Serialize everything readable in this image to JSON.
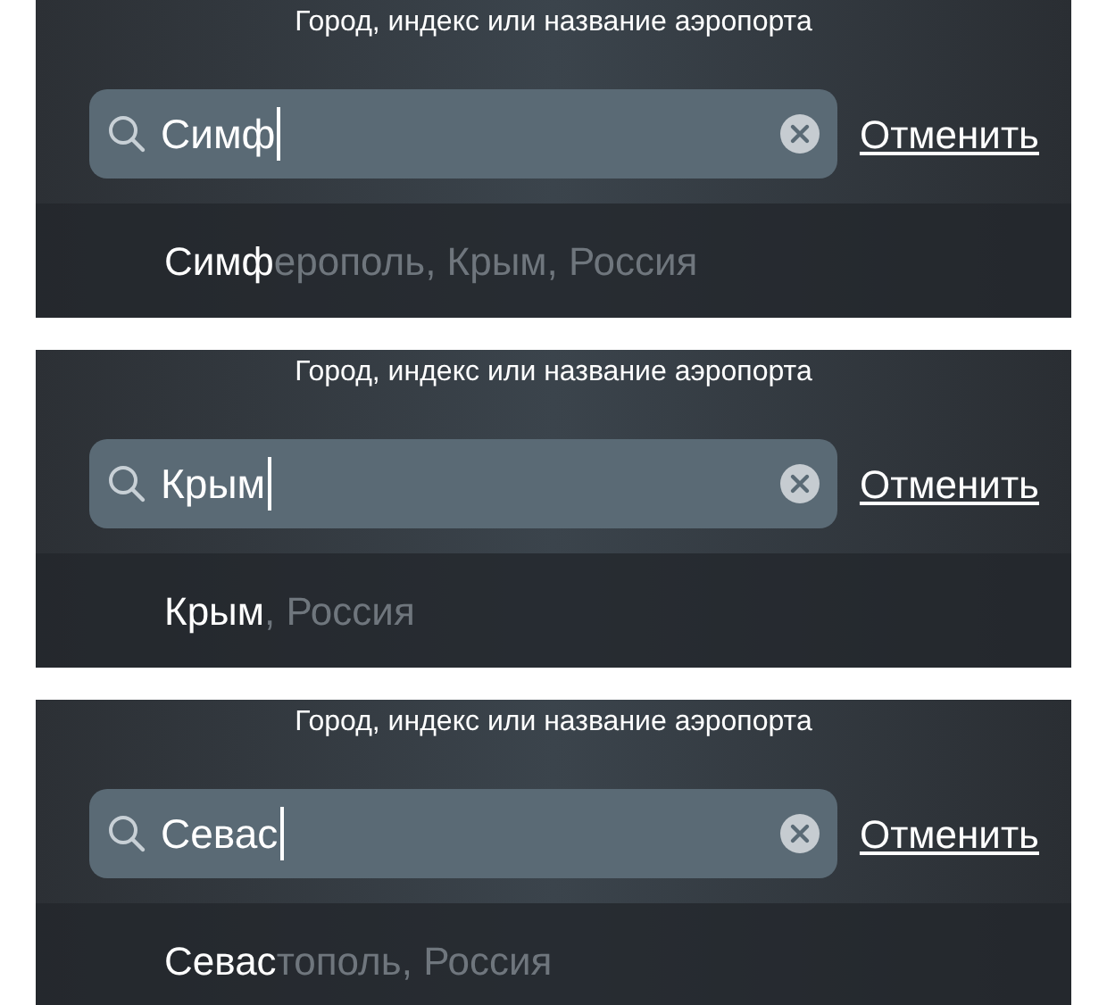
{
  "panels": [
    {
      "title": "Город, индекс или название аэропорта",
      "query": "Симф",
      "cancel": "Отменить",
      "result": "**Симф**ерополь, Крым, Россия"
    },
    {
      "title": "Город, индекс или название аэропорта",
      "query": "Крым",
      "cancel": "Отменить",
      "result": "**Крым**, Россия"
    },
    {
      "title": "Город, индекс или название аэропорта",
      "query": "Севас",
      "cancel": "Отменить",
      "result": "**Севас**тополь, Россия"
    }
  ]
}
